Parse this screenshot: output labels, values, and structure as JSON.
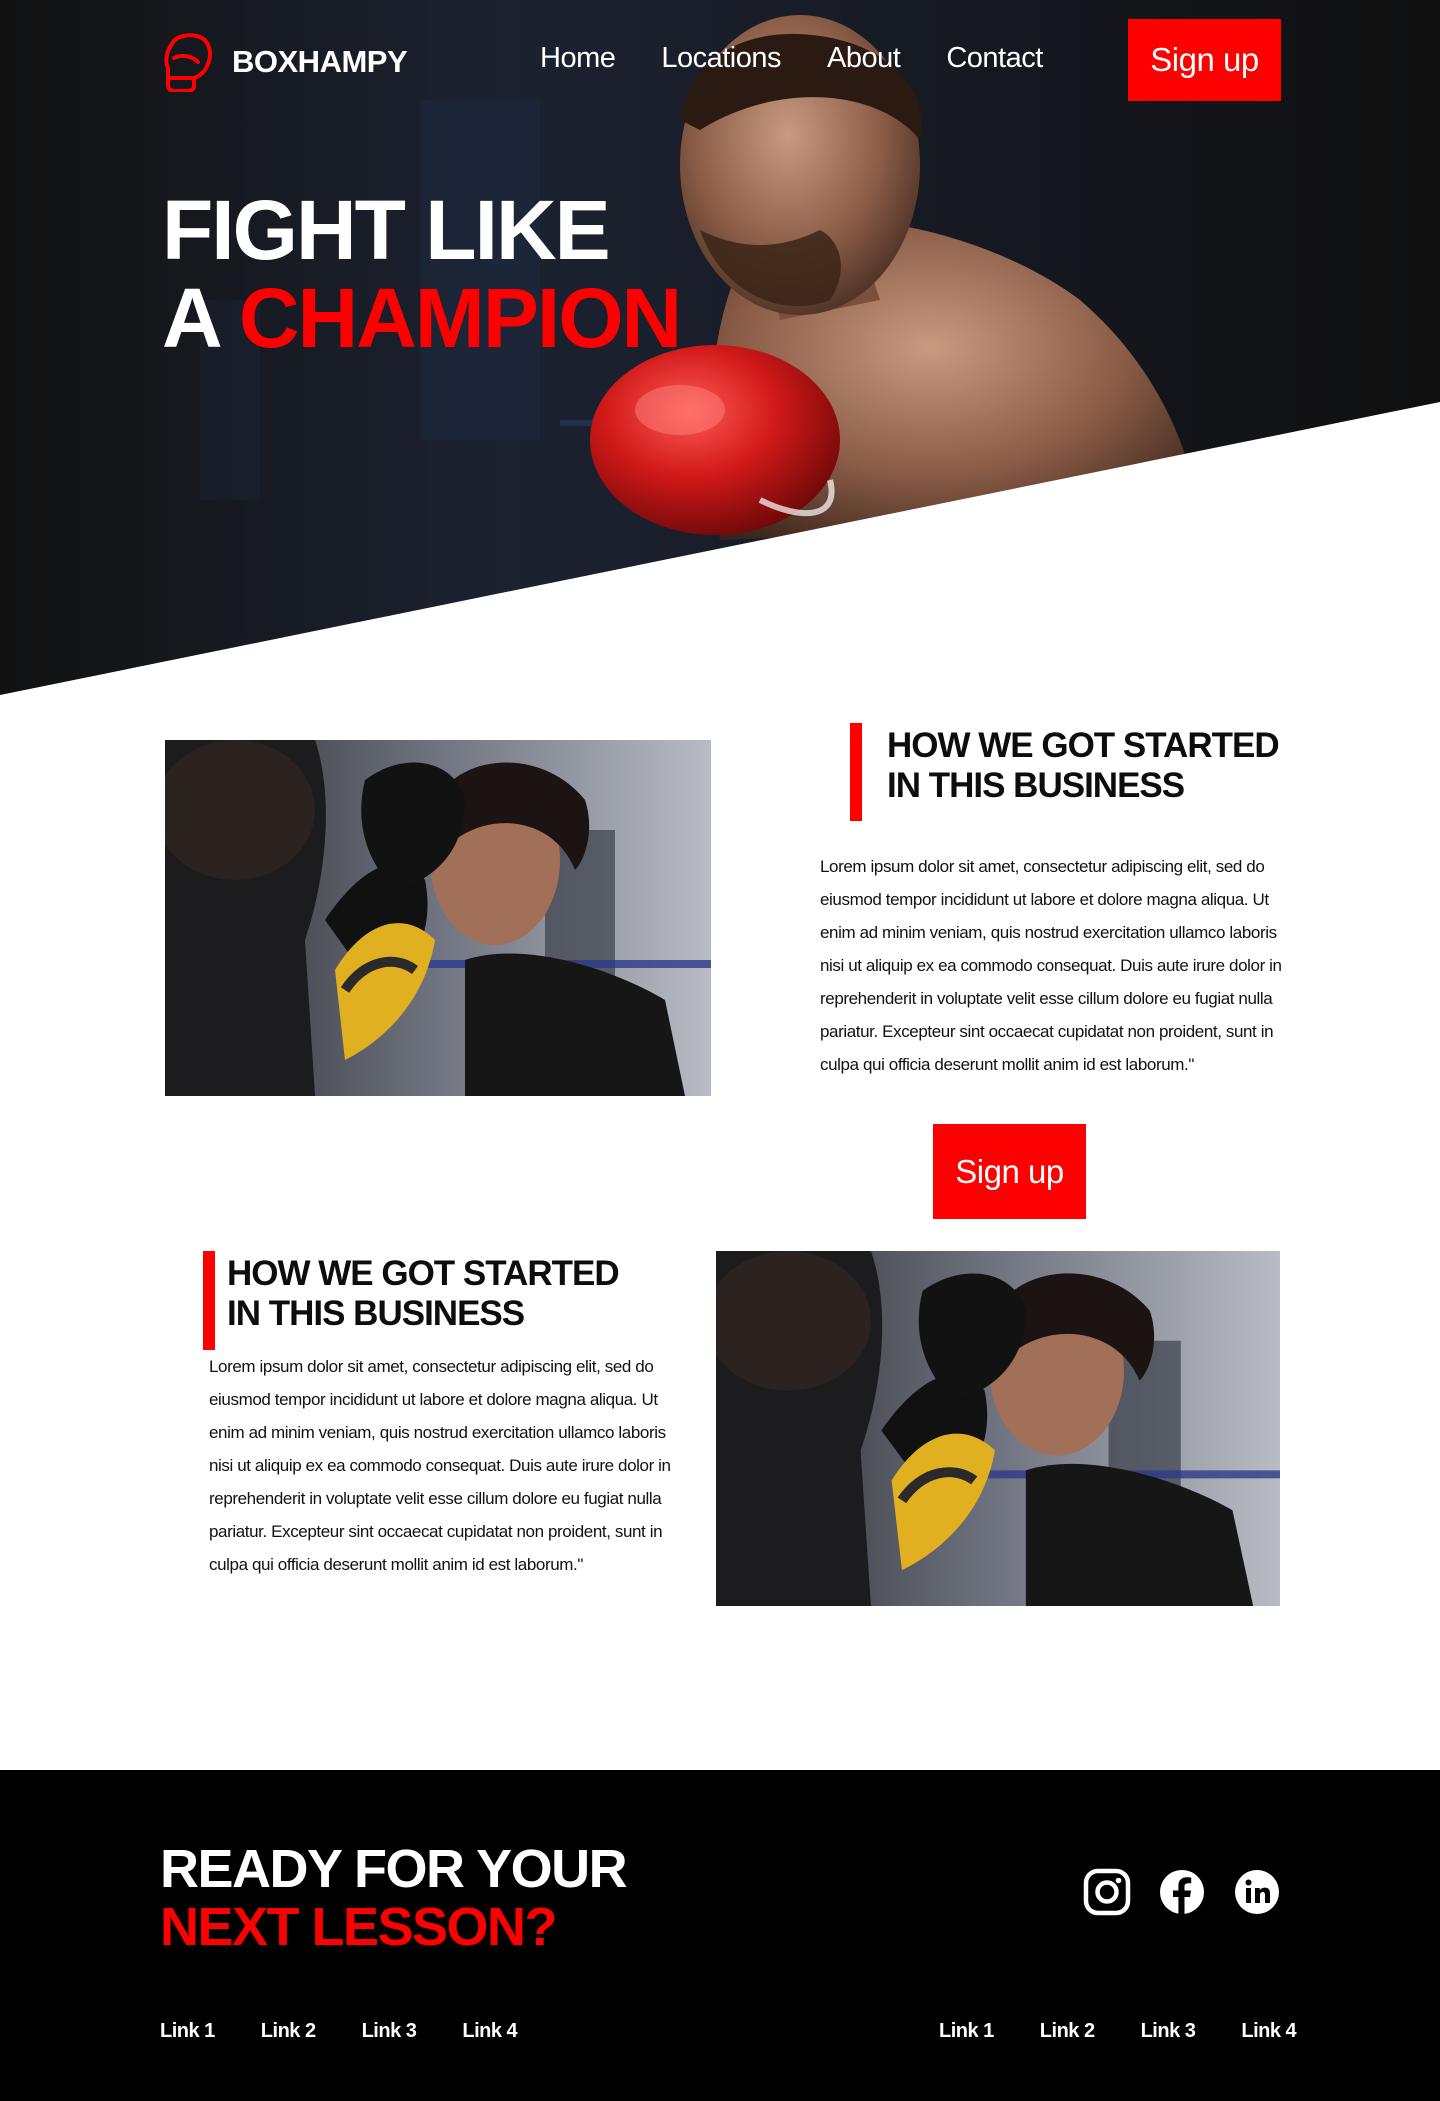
{
  "brand": {
    "name": "BOXHAMPY",
    "logo_icon": "boxing-glove-icon",
    "accent_color": "#ff0000",
    "dark_color": "#161616"
  },
  "nav": {
    "links": [
      "Home",
      "Locations",
      "About",
      "Contact"
    ],
    "signup_label": "Sign up"
  },
  "hero": {
    "title_line1": "FIGHT LIKE",
    "title_line2_prefix": "A ",
    "title_line2_accent": "CHAMPION"
  },
  "section1": {
    "heading_line1": "HOW WE GOT STARTED",
    "heading_line2": "IN THIS BUSINESS",
    "body": "Lorem ipsum dolor sit amet, consectetur adipiscing elit, sed do eiusmod tempor incididunt ut labore et dolore magna aliqua. Ut enim ad minim veniam, quis nostrud exercitation ullamco laboris nisi ut aliquip ex ea commodo consequat. Duis aute irure dolor in reprehenderit in voluptate velit esse cillum dolore eu fugiat nulla pariatur. Excepteur sint occaecat cupidatat non proident, sunt in culpa qui officia deserunt mollit anim id est laborum.\"",
    "signup_label": "Sign up"
  },
  "section2": {
    "heading_line1": "HOW WE GOT STARTED",
    "heading_line2": "IN THIS BUSINESS",
    "body": "Lorem ipsum dolor sit amet, consectetur adipiscing elit, sed do eiusmod tempor incididunt ut labore et dolore magna aliqua. Ut enim ad minim veniam, quis nostrud exercitation ullamco laboris nisi ut aliquip ex ea commodo consequat. Duis aute irure dolor in reprehenderit in voluptate velit esse cillum dolore eu fugiat nulla pariatur. Excepteur sint occaecat cupidatat non proident, sunt in culpa qui officia deserunt mollit anim id est laborum.\""
  },
  "footer": {
    "title_line1": "READY FOR YOUR",
    "title_line2": "NEXT LESSON?",
    "socials": [
      "instagram-icon",
      "facebook-icon",
      "linkedin-icon"
    ],
    "links_left": [
      "Link 1",
      "Link 2",
      "Link 3",
      "Link 4"
    ],
    "links_right": [
      "Link 1",
      "Link 2",
      "Link 3",
      "Link 4"
    ]
  }
}
